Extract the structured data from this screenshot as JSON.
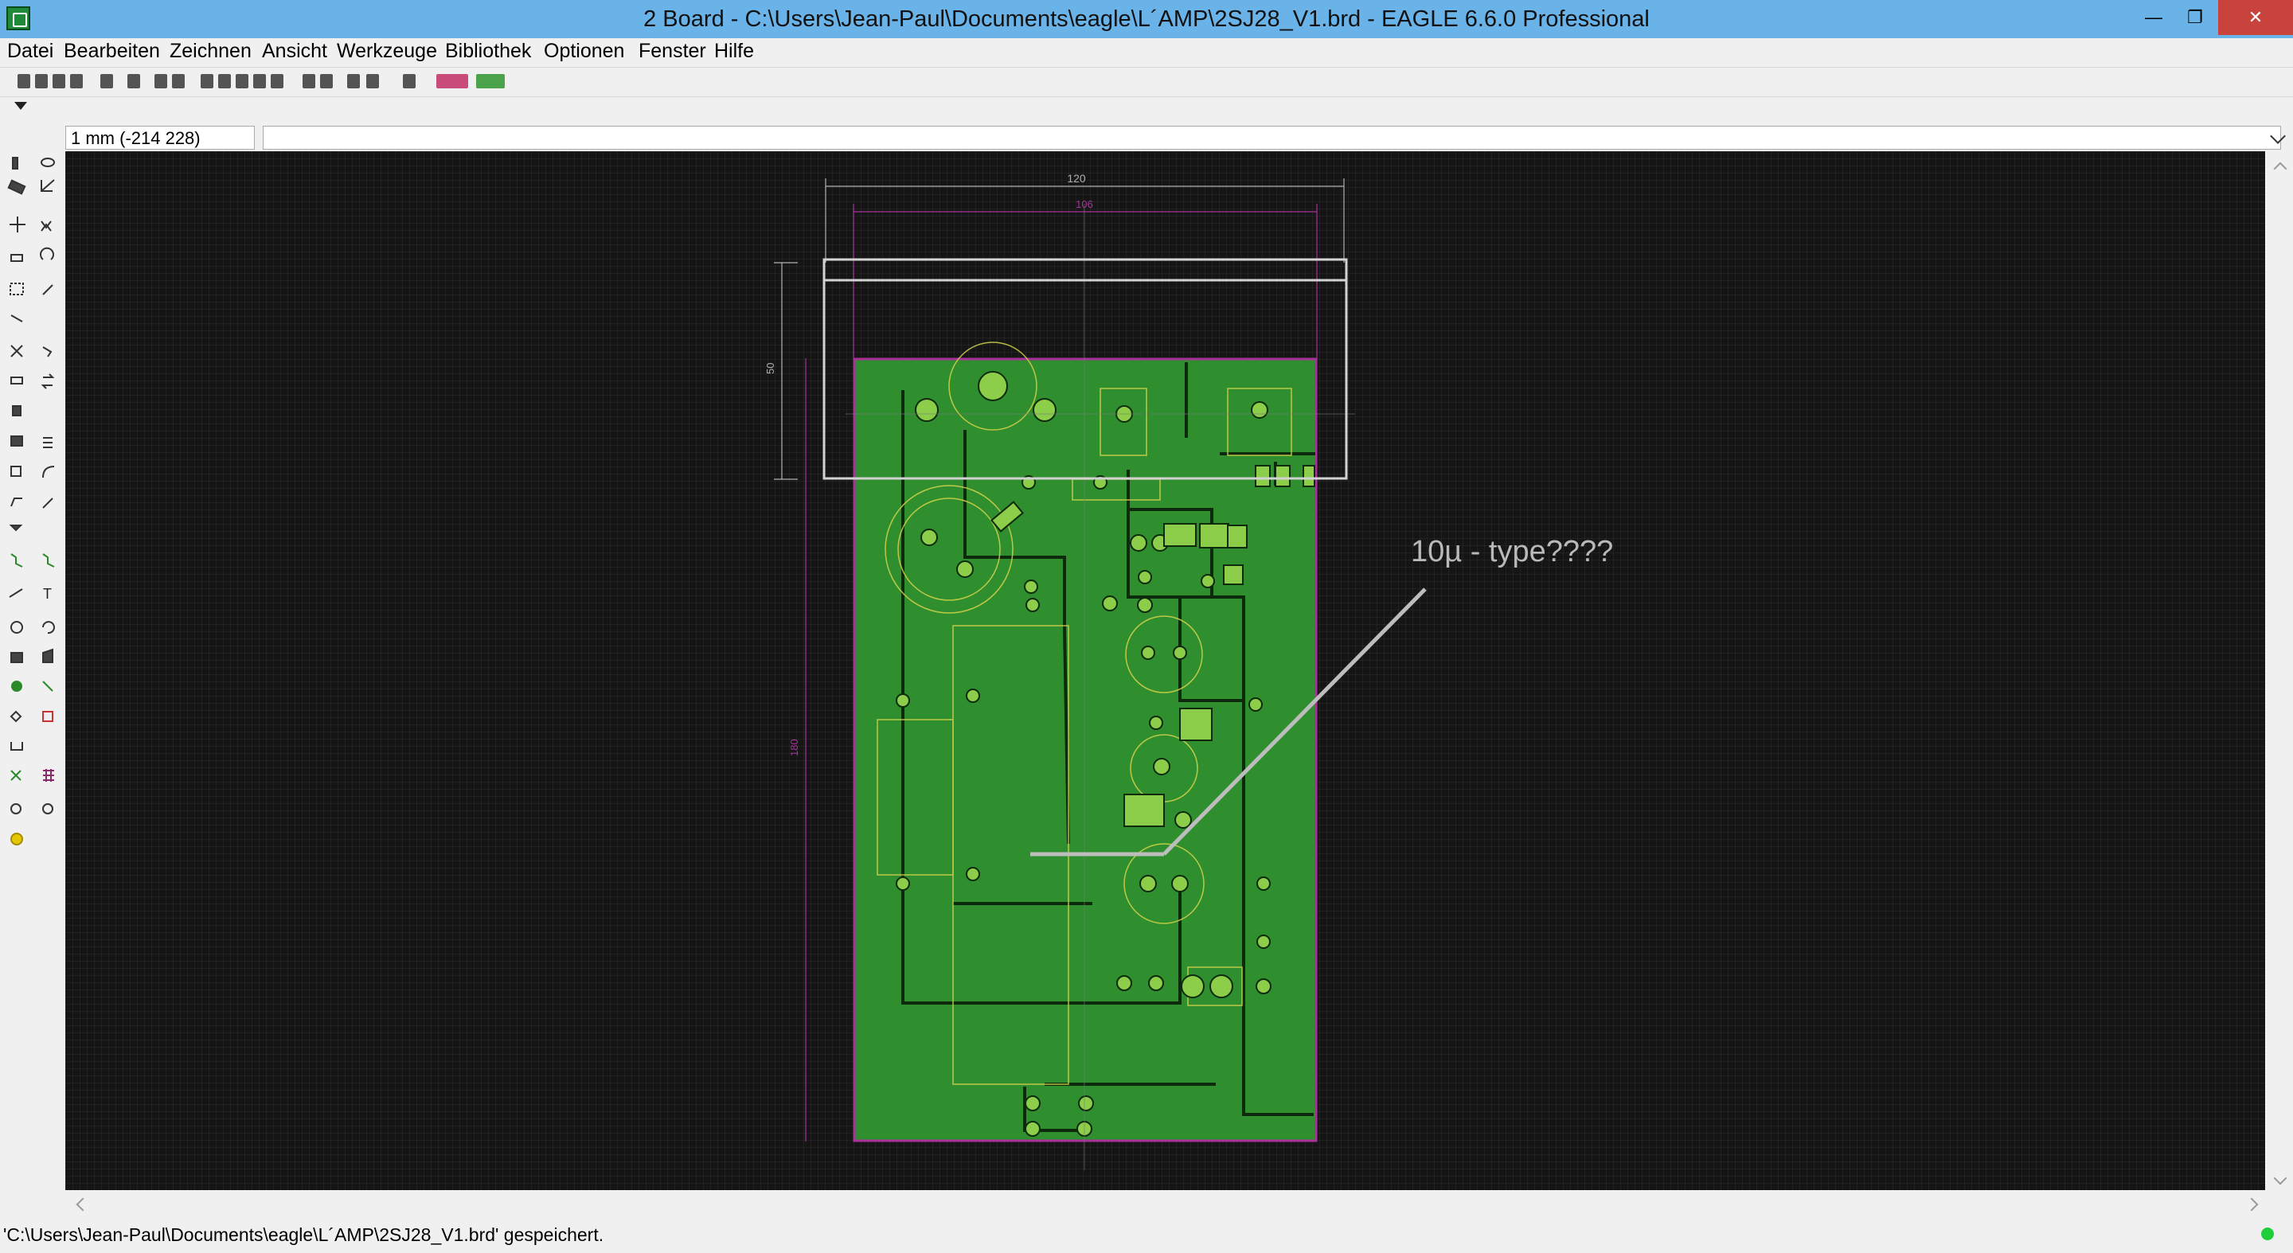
{
  "window": {
    "title": "2 Board - C:\\Users\\Jean-Paul\\Documents\\eagle\\L´AMP\\2SJ28_V1.brd - EAGLE 6.6.0 Professional",
    "minimize_glyph": "—",
    "restore_glyph": "❐",
    "close_glyph": "✕"
  },
  "menu": [
    "Datei",
    "Bearbeiten",
    "Zeichnen",
    "Ansicht",
    "Werkzeuge",
    "Bibliothek",
    "Optionen",
    "Fenster",
    "Hilfe"
  ],
  "coordinate_readout": "1 mm (-214 228)",
  "command_line": {
    "value": ""
  },
  "board": {
    "annotation": "10µ - type????",
    "dimension_width_top": "120",
    "dimension_width_inner": "106",
    "dimension_height_short": "50",
    "dimension_height_long": "180"
  },
  "status": {
    "message": "'C:\\Users\\Jean-Paul\\Documents\\eagle\\L´AMP\\2SJ28_V1.brd' gespeichert."
  },
  "colors": {
    "titlebar": "#6ab3e8",
    "canvas": "#151515",
    "copper": "#2f8f2f",
    "outline": "#a8329a",
    "silk": "#d2d2d2"
  }
}
